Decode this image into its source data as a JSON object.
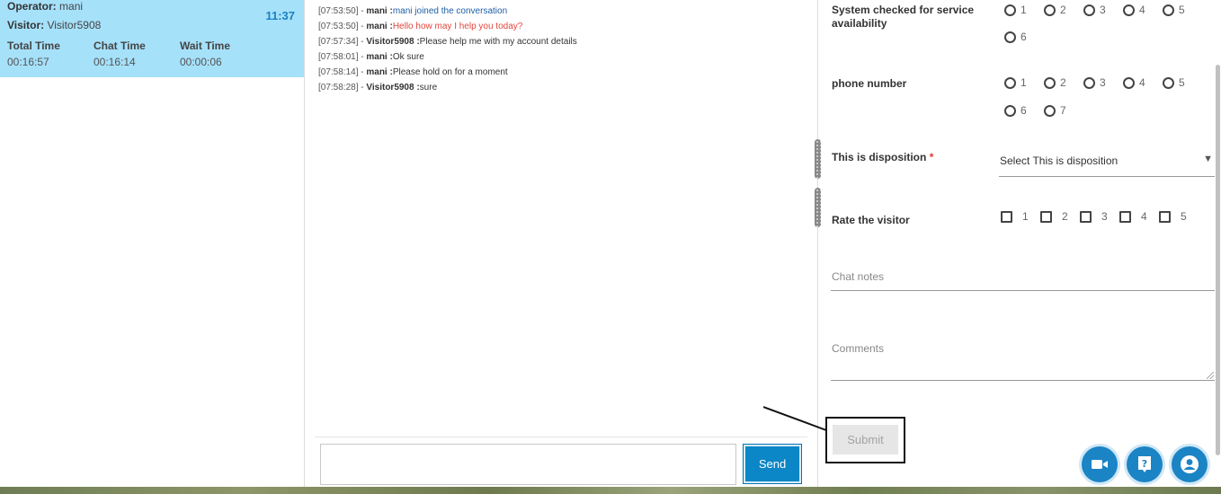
{
  "session": {
    "operator_label": "Operator:",
    "operator_name": "mani",
    "visitor_label": "Visitor:",
    "visitor_name": "Visitor5908",
    "clock": "11:37",
    "total_time_label": "Total Time",
    "total_time": "00:16:57",
    "chat_time_label": "Chat Time",
    "chat_time": "00:16:14",
    "wait_time_label": "Wait Time",
    "wait_time": "00:00:06"
  },
  "transcript": [
    {
      "time": "[07:53:50] -",
      "sender": "mani :",
      "text": "mani joined the conversation",
      "kind": "system"
    },
    {
      "time": "[07:53:50] -",
      "sender": "mani :",
      "text": "Hello how may I help you today?",
      "kind": "operator"
    },
    {
      "time": "[07:57:34] -",
      "sender": "Visitor5908 :",
      "text": "Please help me with my account details",
      "kind": "normal"
    },
    {
      "time": "[07:58:01] -",
      "sender": "mani :",
      "text": "Ok sure",
      "kind": "normal"
    },
    {
      "time": "[07:58:14] -",
      "sender": "mani :",
      "text": "Please hold on for a moment",
      "kind": "normal"
    },
    {
      "time": "[07:58:28] -",
      "sender": "Visitor5908 :",
      "text": "sure",
      "kind": "normal"
    }
  ],
  "composer": {
    "input_value": "",
    "send_label": "Send"
  },
  "form": {
    "q1": {
      "label": "System checked for service availability",
      "options": [
        "1",
        "2",
        "3",
        "4",
        "5",
        "6"
      ]
    },
    "q2": {
      "label": "phone number",
      "options": [
        "1",
        "2",
        "3",
        "4",
        "5",
        "6",
        "7"
      ]
    },
    "q3": {
      "label": "This is disposition",
      "required_mark": "*",
      "selected": "Select This is disposition"
    },
    "q4": {
      "label": "Rate the visitor",
      "options": [
        "1",
        "2",
        "3",
        "4",
        "5"
      ]
    },
    "chat_notes_placeholder": "Chat notes",
    "comments_placeholder": "Comments",
    "submit_label": "Submit"
  },
  "colors": {
    "session_card_bg": "#a6e1fa",
    "accent": "#1b84c5",
    "system_text": "#1d5fa8",
    "operator_text": "#e2463c",
    "required": "#e5352e"
  },
  "fab_icons": [
    "video-camera-icon",
    "help-icon",
    "user-profile-icon"
  ]
}
